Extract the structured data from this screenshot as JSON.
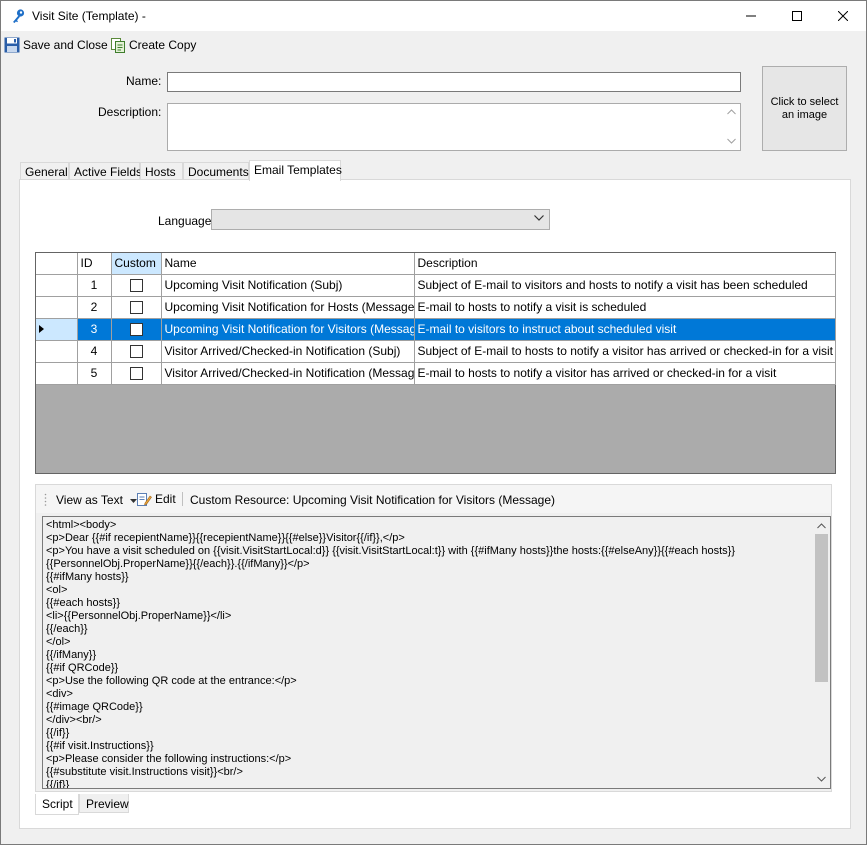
{
  "window": {
    "title": "Visit Site (Template)  -",
    "accent": "#0078d7"
  },
  "toolbar": {
    "save_close_label": "Save and Close",
    "create_copy_label": "Create Copy"
  },
  "form": {
    "name_label": "Name:",
    "name_value": "",
    "description_label": "Description:",
    "description_value": "",
    "image_button_label": "Click to select an image"
  },
  "tabs": [
    {
      "label": "General"
    },
    {
      "label": "Active Fields"
    },
    {
      "label": "Hosts"
    },
    {
      "label": "Documents"
    },
    {
      "label": "Email Templates",
      "active": true
    }
  ],
  "language": {
    "label": "Language:",
    "value": ""
  },
  "grid": {
    "columns": [
      "ID",
      "Custom",
      "Name",
      "Description"
    ],
    "rows": [
      {
        "id": "1",
        "custom": false,
        "name": "Upcoming Visit Notification (Subj)",
        "description": "Subject of E-mail to visitors and hosts to notify a visit has been scheduled"
      },
      {
        "id": "2",
        "custom": false,
        "name": "Upcoming Visit Notification for Hosts (Message)",
        "description": "E-mail to hosts to notify a visit is scheduled"
      },
      {
        "id": "3",
        "custom": false,
        "name": "Upcoming Visit Notification for Visitors (Message)",
        "description": "E-mail to visitors to instruct about scheduled visit",
        "selected": true
      },
      {
        "id": "4",
        "custom": false,
        "name": "Visitor Arrived/Checked-in Notification (Subj)",
        "description": "Subject of E-mail to hosts to notify a visitor has arrived or checked-in for a visit"
      },
      {
        "id": "5",
        "custom": false,
        "name": "Visitor Arrived/Checked-in Notification (Message)",
        "description": "E-mail to hosts to notify a visitor has arrived or checked-in for a visit"
      }
    ]
  },
  "editor": {
    "view_as_label": "View as Text",
    "edit_label": "Edit",
    "resource_label": "Custom Resource: Upcoming Visit Notification for Visitors (Message)",
    "lines": [
      "<html><body>",
      "<p>Dear {{#if recepientName}}{{recepientName}}{{#else}}Visitor{{/if}},</p>",
      "<p>You have a visit scheduled on {{visit.VisitStartLocal:d}} {{visit.VisitStartLocal:t}} with {{#ifMany hosts}}the hosts:{{#elseAny}}{{#each hosts}}",
      "{{PersonnelObj.ProperName}}{{/each}}.{{/ifMany}}</p>",
      "{{#ifMany hosts}}",
      "<ol>",
      "{{#each hosts}}",
      "<li>{{PersonnelObj.ProperName}}</li>",
      "{{/each}}",
      "</ol>",
      "{{/ifMany}}",
      "{{#if QRCode}}",
      "<p>Use the following QR code at the entrance:</p>",
      "<div>",
      "{{#image QRCode}}",
      "</div><br/>",
      "{{/if}}",
      "{{#if visit.Instructions}}",
      "<p>Please consider the following instructions:</p>",
      "{{#substitute visit.Instructions visit}}<br/>",
      "{{/if}}"
    ]
  },
  "bottom_tabs": [
    {
      "label": "Script",
      "active": true
    },
    {
      "label": "Preview"
    }
  ]
}
